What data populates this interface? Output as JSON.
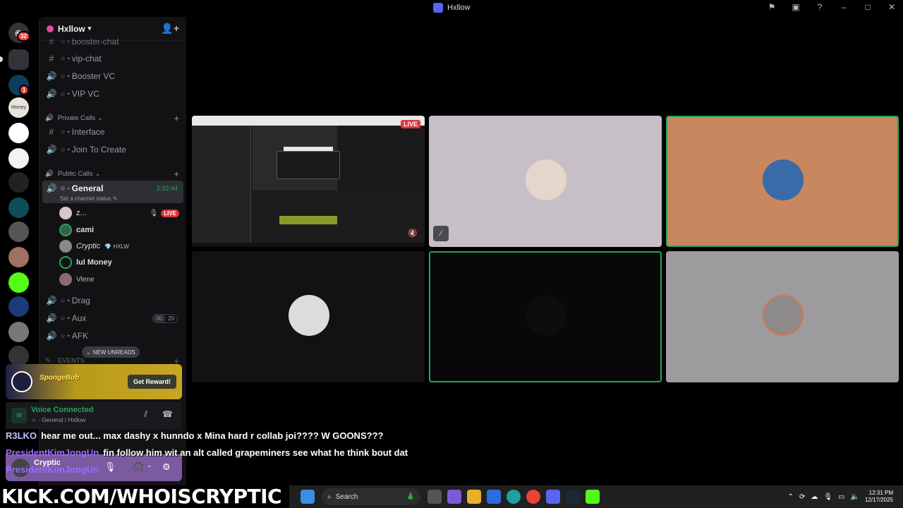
{
  "window": {
    "title": "Hxllow"
  },
  "guilds": {
    "home_badge": "32",
    "ny_badge": "1",
    "money_label": "Money"
  },
  "server": {
    "name": "Hxllow"
  },
  "channels": [
    {
      "icon": "#",
      "name": "booster-chat"
    },
    {
      "icon": "#",
      "name": "vip-chat"
    },
    {
      "icon": "speaker",
      "name": "Booster VC"
    },
    {
      "icon": "speaker",
      "name": "VIP VC"
    }
  ],
  "categories": {
    "private": "Private Calls",
    "public": "Public Calls",
    "events": "EVENTS"
  },
  "private_channels": [
    {
      "icon": "#",
      "name": "Interface"
    },
    {
      "icon": "speaker",
      "name": "Join To Create"
    }
  ],
  "general": {
    "name": "General",
    "timer": "2:32:44",
    "status": "Set a channel status"
  },
  "members": [
    {
      "name": "z...",
      "live": "LIVE"
    },
    {
      "name": "cami"
    },
    {
      "name": "Cryptic",
      "tag": "HXLW"
    },
    {
      "name": "lul Money"
    },
    {
      "name": "Vlene"
    }
  ],
  "other_channels": [
    {
      "name": "Drag"
    },
    {
      "name": "Aux",
      "count_a": "00",
      "count_b": "20"
    },
    {
      "name": "AFK"
    }
  ],
  "new_unreads": "NEW UNREADS",
  "promo": {
    "logo_text": "SpongeBob",
    "button": "Get Reward!"
  },
  "voice": {
    "status": "Voice Connected",
    "channel": "General / Hxllow"
  },
  "user": {
    "name": "Cryptic"
  },
  "stream": {
    "live": "LIVE"
  },
  "chat": [
    {
      "user": "R3LKO",
      "message": "hear me out... max dashy x hunndo x Mina hard r collab joi???? W GOONS???"
    },
    {
      "user": "PresidentKimJongUn",
      "message": "fin follow him wit an alt called grapeminers see what he think bout dat"
    },
    {
      "user": "PresidentKimJongUn",
      "message": ""
    }
  ],
  "overlay": {
    "kick_url": "KICK.COM/WHOISCRYPTIC"
  },
  "taskbar": {
    "search": "Search",
    "time": "12:31 PM",
    "date": "12/17/2025"
  },
  "colors": {
    "accent_green": "#23a55a",
    "live_red": "#da373c",
    "peach_tile": "#c8875e",
    "lilac_tile": "#c6bfc6",
    "grey_tile": "#9e9b9e"
  }
}
